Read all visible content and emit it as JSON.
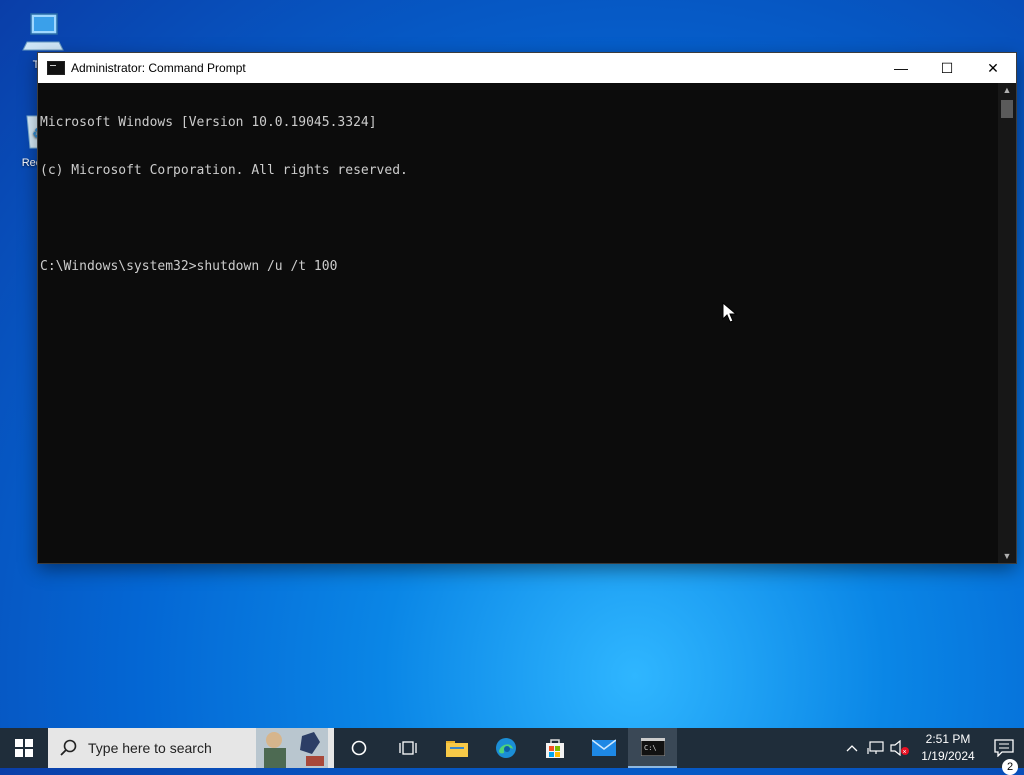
{
  "desktop": {
    "icons": [
      {
        "label": "This"
      },
      {
        "label": "Recyc"
      }
    ]
  },
  "window": {
    "title": "Administrator: Command Prompt",
    "controls": {
      "minimize": "—",
      "maximize": "☐",
      "close": "✕"
    },
    "console_lines": [
      "Microsoft Windows [Version 10.0.19045.3324]",
      "(c) Microsoft Corporation. All rights reserved.",
      "",
      "C:\\Windows\\system32>shutdown /u /t 100"
    ]
  },
  "taskbar": {
    "search_placeholder": "Type here to search",
    "clock": {
      "time": "2:51 PM",
      "date": "1/19/2024"
    },
    "notification_count": "2"
  }
}
